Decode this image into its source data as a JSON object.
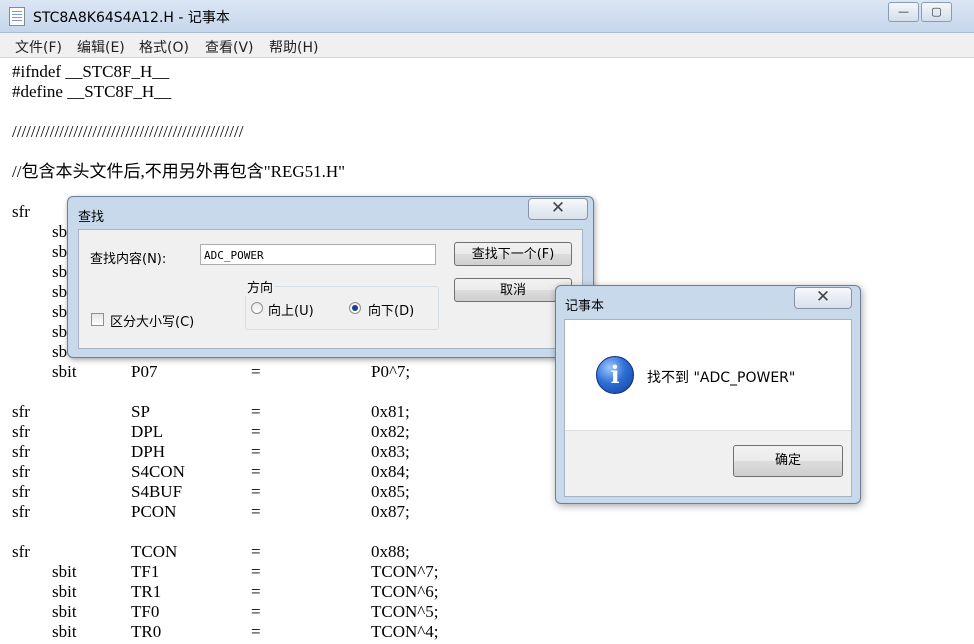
{
  "window": {
    "title": "STC8A8K64S4A12.H - 记事本",
    "minimize_glyph": "—",
    "maximize_glyph": "▢"
  },
  "menu": [
    {
      "label": "文件(F)"
    },
    {
      "label": "编辑(E)"
    },
    {
      "label": "格式(O)"
    },
    {
      "label": "查看(V)"
    },
    {
      "label": "帮助(H)"
    }
  ],
  "editor": {
    "lines": [
      {
        "text": "#ifndef __STC8F_H__"
      },
      {
        "text": "#define __STC8F_H__"
      },
      {
        "text": ""
      },
      {
        "text": "/////////////////////////////////////////////////"
      },
      {
        "text": ""
      },
      {
        "text": "//包含本头文件后,不用另外再包含\"REG51.H\""
      },
      {
        "text": ""
      },
      {
        "a": "sfr",
        "b": "",
        "c": "",
        "d": ""
      },
      {
        "a": "",
        "b": "sb",
        "c": "",
        "d": ""
      },
      {
        "a": "",
        "b": "sb",
        "c": "",
        "d": ""
      },
      {
        "a": "",
        "b": "sb",
        "c": "",
        "d": ""
      },
      {
        "a": "",
        "b": "sb",
        "c": "",
        "d": ""
      },
      {
        "a": "",
        "b": "sb",
        "c": "",
        "d": ""
      },
      {
        "a": "",
        "b": "sb",
        "c": "",
        "d": ""
      },
      {
        "a": "",
        "b": "sb",
        "c": "",
        "d": ""
      },
      {
        "a": "",
        "b": "sbit",
        "c": "P07",
        "eq": "=",
        "d": "P0^7;"
      },
      {
        "text": ""
      },
      {
        "a": "sfr",
        "c": "SP",
        "eq": "=",
        "d": "0x81;"
      },
      {
        "a": "sfr",
        "c": "DPL",
        "eq": "=",
        "d": "0x82;"
      },
      {
        "a": "sfr",
        "c": "DPH",
        "eq": "=",
        "d": "0x83;"
      },
      {
        "a": "sfr",
        "c": "S4CON",
        "eq": "=",
        "d": "0x84;"
      },
      {
        "a": "sfr",
        "c": "S4BUF",
        "eq": "=",
        "d": "0x85;"
      },
      {
        "a": "sfr",
        "c": "PCON",
        "eq": "=",
        "d": "0x87;"
      },
      {
        "text": ""
      },
      {
        "a": "sfr",
        "c": "TCON",
        "eq": "=",
        "d": "0x88;"
      },
      {
        "b": "sbit",
        "c": "TF1",
        "eq": "=",
        "d": "TCON^7;"
      },
      {
        "b": "sbit",
        "c": "TR1",
        "eq": "=",
        "d": "TCON^6;"
      },
      {
        "b": "sbit",
        "c": "TF0",
        "eq": "=",
        "d": "TCON^5;"
      },
      {
        "b": "sbit",
        "c": "TR0",
        "eq": "=",
        "d": "TCON^4;"
      }
    ]
  },
  "find_dialog": {
    "title": "查找",
    "find_label": "查找内容(N):",
    "find_value": "ADC_POWER",
    "find_next_button": "查找下一个(F)",
    "cancel_button": "取消",
    "direction_label": "方向",
    "up_label": "向上(U)",
    "down_label": "向下(D)",
    "direction_selected": "down",
    "match_case_label": "区分大小写(C)",
    "match_case_checked": false,
    "close_glyph": "✕"
  },
  "message_box": {
    "title": "记事本",
    "icon": "info-icon",
    "icon_glyph": "i",
    "text": "找不到 \"ADC_POWER\"",
    "ok_button": "确定",
    "close_glyph": "✕"
  }
}
